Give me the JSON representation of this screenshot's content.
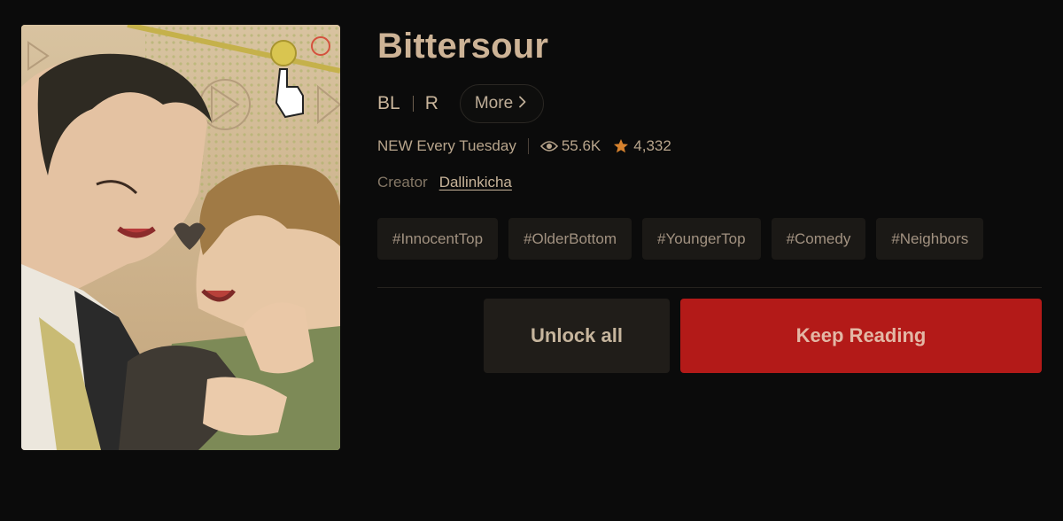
{
  "series": {
    "title": "Bittersour",
    "cover_alt": "Bittersour cover art",
    "genres": [
      "BL",
      "R"
    ],
    "more_label": "More",
    "schedule": "NEW Every Tuesday",
    "views": "55.6K",
    "rating": "4,332",
    "creator_label": "Creator",
    "creator_name": "Dallinkicha",
    "tags": [
      "#InnocentTop",
      "#OlderBottom",
      "#YoungerTop",
      "#Comedy",
      "#Neighbors"
    ]
  },
  "actions": {
    "unlock_label": "Unlock all",
    "keep_reading_label": "Keep Reading"
  },
  "icons": {
    "views": "eye-icon",
    "rating": "star-icon",
    "more": "chevron-right-icon"
  },
  "colors": {
    "background": "#0b0b0b",
    "accent_red": "#b31a18",
    "star": "#d7822e",
    "title": "#cdb396"
  }
}
